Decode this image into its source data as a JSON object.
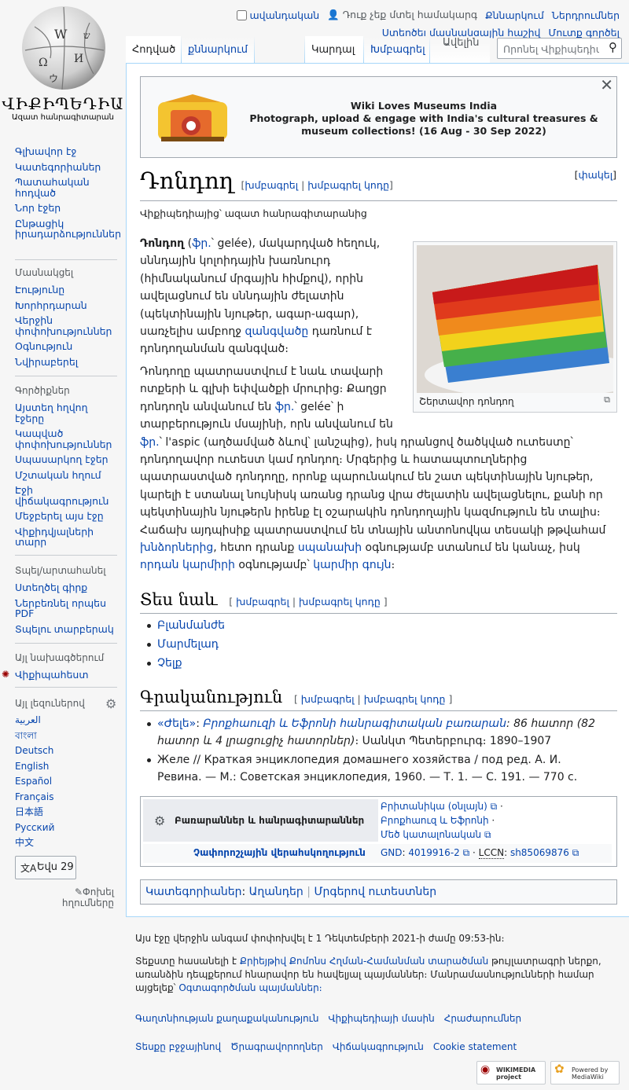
{
  "logo": {
    "wordmark": "ՎԻՔԻՊԵԴԻԱ",
    "tagline": "Ազատ հանրագիտարան"
  },
  "personal": {
    "anon_talk": "ավանդական",
    "not_logged": "Դուք չեք մտել համակարգ",
    "talk": "Քննարկում",
    "contribs": "Ներդրումներ",
    "create_account": "Ստեղծել մասնակցային հաշիվ",
    "login": "Մուտք գործել"
  },
  "tabs": {
    "article": "Հոդված",
    "talk": "քննարկում",
    "read": "Կարդալ",
    "edit": "Խմբագրել",
    "more": "Ավելին",
    "search_placeholder": "Որոնել Վիքիպեդիայում"
  },
  "sidebar": {
    "main": [
      "Գլխավոր էջ",
      "Կատեգորիաներ",
      "Պատահական հոդված",
      "Նոր էջեր",
      "Ընթացիկ իրադարձություններ"
    ],
    "participate": {
      "title": "Մասնակցել",
      "items": [
        "Էությունը",
        "Խորհրդարան",
        "Վերջին փոփոխություններ",
        "Օգնություն",
        "Նվիրաբերել"
      ]
    },
    "tools": {
      "title": "Գործիքներ",
      "items": [
        "Այստեղ հղվող էջերը",
        "Կապված փոփոխություններ",
        "Սպասարկող էջեր",
        "Մշտական հղում",
        "Էջի վիճակագրություն",
        "Մեջբերել այս էջը",
        "Վիքիդվյալների տարր"
      ]
    },
    "print": {
      "title": "Տպել/արտահանել",
      "items": [
        "Ստեղծել գիրք",
        "Ներբեռնել որպես PDF",
        "Տպելու տարբերակ"
      ]
    },
    "projects": {
      "title": "Այլ նախագծերում",
      "items": [
        "Վիքիպահեստ"
      ]
    },
    "languages": {
      "title": "Այլ լեզուներով",
      "items": [
        "العربية",
        "বাংলা",
        "Deutsch",
        "English",
        "Español",
        "Français",
        "日本語",
        "Русский",
        "中文"
      ],
      "count_button": "Եվս 29",
      "edit_links": "Փոխել հղումները"
    }
  },
  "banner": {
    "title": "Wiki Loves Museums India",
    "text": "Photograph, upload & engage with India's cultural treasures & museum collections! (16 Aug - 30 Sep 2022)"
  },
  "article": {
    "title": "Դոնդող",
    "edit": "խմբագրել",
    "edit_source": "խմբագրել կոդը",
    "hide": "փակել",
    "site_sub": "Վիքիպեդիայից՝ ազատ հանրագիտարանից",
    "p1": {
      "bold": "Դոնդող",
      "fr": "ֆր.",
      "rest1": "՝ gelée), մակարդված հեղուկ, սննդային կոլոիդային խառնուրդ (հիմնականում մրգային հիմքով), որին ավելացնում են սննդային ժելատին (պեկտինային նյութեր, ագար-ագար), սառչելիս ամբողջ ",
      "link1": "զանգվածը",
      "rest2": " դառնում է դոնդողանման զանգված։"
    },
    "p2": {
      "a": "Դոնդողը պատրաստվում է նաև տավարի ոտքերի և գլխի եփվածքի մրուրից։ Քաղցր դոնդողն անվանում են ",
      "fr1": "ֆր.",
      "b": "՝ gelée՝ ի տարբերություն մսայինի, որն անվանում են ",
      "fr2": "ֆր.",
      "c": "՝ l'aspic (աղծամված ձևով՝ լանշպից), իսկ դրանցով ծածկված ուտեստը՝ դոնդողավոր ուտեստ կամ դոնդող։ Մրգերից և հատապտուղներից պատրաստված դոնդողը, որոնք պարունակում են շատ պեկտինային նյութեր, կարելի է ստանալ նույնիսկ առանց դրանց վրա ժելատին ավելացնելու, քանի որ պեկտինային նյութերն իրենք էլ օշարակին դոնդողային կազմություն են տալիս։ Հաճախ այդպիսիք պատրաստվում են տնային անտոնովկա տեսակի թթվահամ ",
      "l1": "խնձորներից",
      "d": ", հետո դրանք ",
      "l2": "սպանախի",
      "e": " օգնությամբ ստանում են կանաչ, իսկ ",
      "l3": "որդան կարմիրի",
      "f": " օգնությամբ՝ ",
      "l4": "կարմիր գույն",
      "g": "։"
    },
    "thumb_caption": "Շերտավոր դոնդող",
    "see_also": {
      "title": "Տես նաև",
      "items": [
        "Բլանմանժե",
        "Մարմելադ",
        "Չելք"
      ]
    },
    "lit": {
      "title": "Գրականություն",
      "item1": {
        "link": "«Ժելե»",
        "link2": "Բրոքհաուզի և Եֆրոնի հանրագիտական բառարան",
        "rest": ": 86 հատոր (82 հատոր և 4 լրացուցիչ հատորներ)",
        "pub": "։ Սանկտ Պետերբուրգ։ 1890–1907"
      },
      "item2": "Желе // Краткая энциклопедия домашнего хозяйства / под ред. А. И. Ревина. — М.: Советская энциклопедия, 1960. — Т. 1. — С. 191. — 770 с."
    },
    "authority": {
      "row1_label": "Բառարաններ և հանրագիտարաններ",
      "links": [
        "Բրիտանիկա (օնլայն)",
        "Բրոքհաուզ և Եֆրոնի",
        "Մեծ կատալոնական"
      ],
      "row2_label": "Չափորոշչային վերահսկողություն",
      "gnd": "GND",
      "gnd_val": "4019916-2",
      "lccn": "LCCN",
      "lccn_val": "sh85069876"
    },
    "categories": {
      "label": "Կատեգորիաներ",
      "items": [
        "Աղանդեր",
        "Մրգերով ուտեստներ"
      ]
    }
  },
  "footer": {
    "modified": "Այս էջը վերջին անգամ փոփոխվել է 1 Դեկտեմբերի 2021-ի ժամը 09:53-ին։",
    "license_a": "Տեքստը հասանելի է ",
    "license_link": "Քրիեյթիվ Քոմոնս Հղման-Համանման տարածման",
    "license_b": " թույլատրագրի ներքո, առանձին դեպքերում հնարավոր են հավելյալ պայմաններ։ Մանրամասնությունների համար այցելեք՝ ",
    "terms": "Օգտագործման պայմաններ։",
    "links1": [
      "Գաղտնիության քաղաքականություն",
      "Վիքիպեդիայի մասին",
      "Հրաժարումներ"
    ],
    "links2": [
      "Տեսքը բջջայինով",
      "Ծրագրավորողներ",
      "Վիճակագրություն",
      "Cookie statement"
    ],
    "badge1": "WIKIMEDIA project",
    "badge2": "Powered by MediaWiki"
  },
  "colors": {
    "link": "#0645ad",
    "accent": "#36c"
  }
}
